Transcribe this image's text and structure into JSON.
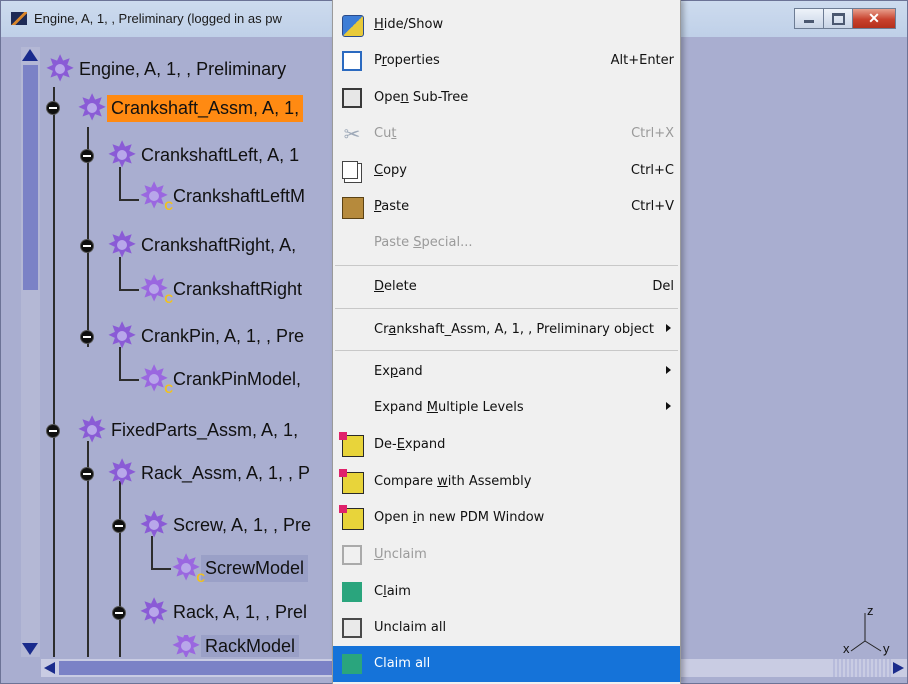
{
  "window": {
    "title": "Engine, A, 1, , Preliminary (logged in as pw",
    "controls": {
      "minimize": "minimize-icon",
      "maximize": "maximize-icon",
      "close": "✕"
    }
  },
  "tree": {
    "nodes": [
      {
        "label": "Engine, A, 1, , Preliminary"
      },
      {
        "label": "Crankshaft_Assm, A, 1,"
      },
      {
        "label": "CrankshaftLeft, A, 1"
      },
      {
        "label": "CrankshaftLeftM"
      },
      {
        "label": "CrankshaftRight, A,"
      },
      {
        "label": "CrankshaftRight"
      },
      {
        "label": "CrankPin, A, 1, , Pre"
      },
      {
        "label": "CrankPinModel,"
      },
      {
        "label": "FixedParts_Assm, A, 1,"
      },
      {
        "label": "Rack_Assm, A, 1, , P"
      },
      {
        "label": "Screw, A, 1, , Pre"
      },
      {
        "label": "ScrewModel"
      },
      {
        "label": "Rack, A, 1, , Prel"
      },
      {
        "label": "RackModel"
      }
    ],
    "model_badge": "C"
  },
  "axis": {
    "z": "z",
    "x": "x",
    "y": "y"
  },
  "menu": {
    "items": [
      {
        "label_pre": "",
        "ul": "H",
        "label_post": "ide/Show",
        "shortcut": "",
        "icon": "hide-show-icon"
      },
      {
        "label_pre": "P",
        "ul": "r",
        "label_post": "operties",
        "shortcut": "Alt+Enter",
        "icon": "properties-icon"
      },
      {
        "label_pre": "Ope",
        "ul": "n",
        "label_post": " Sub-Tree",
        "shortcut": "",
        "icon": "open-subtree-icon"
      },
      {
        "label_pre": "Cu",
        "ul": "t",
        "label_post": "",
        "shortcut": "Ctrl+X",
        "icon": "cut-icon"
      },
      {
        "label_pre": "",
        "ul": "C",
        "label_post": "opy",
        "shortcut": "Ctrl+C",
        "icon": "copy-icon"
      },
      {
        "label_pre": "",
        "ul": "P",
        "label_post": "aste",
        "shortcut": "Ctrl+V",
        "icon": "paste-icon"
      },
      {
        "label_pre": "Paste ",
        "ul": "S",
        "label_post": "pecial...",
        "shortcut": "",
        "icon": ""
      },
      {
        "label_pre": "",
        "ul": "D",
        "label_post": "elete",
        "shortcut": "Del",
        "icon": ""
      },
      {
        "label_pre": "Cr",
        "ul": "a",
        "label_post": "nkshaft_Assm, A, 1, , Preliminary object",
        "shortcut": "",
        "icon": ""
      },
      {
        "label_pre": "Ex",
        "ul": "p",
        "label_post": "and",
        "shortcut": "",
        "icon": ""
      },
      {
        "label_pre": "Expand ",
        "ul": "M",
        "label_post": "ultiple Levels",
        "shortcut": "",
        "icon": ""
      },
      {
        "label_pre": "De-",
        "ul": "E",
        "label_post": "xpand",
        "shortcut": "",
        "icon": "de-expand-icon"
      },
      {
        "label_pre": "Compare ",
        "ul": "w",
        "label_post": "ith Assembly",
        "shortcut": "",
        "icon": "compare-assembly-icon"
      },
      {
        "label_pre": "Open ",
        "ul": "i",
        "label_post": "n new PDM Window",
        "shortcut": "",
        "icon": "pdm-window-icon"
      },
      {
        "label_pre": "",
        "ul": "U",
        "label_post": "nclaim",
        "shortcut": "",
        "icon": "unclaim-icon"
      },
      {
        "label_pre": "C",
        "ul": "l",
        "label_post": "aim",
        "shortcut": "",
        "icon": "claim-icon"
      },
      {
        "label_pre": "Unclaim all",
        "ul": "",
        "label_post": "",
        "shortcut": "",
        "icon": "unclaim-all-icon"
      },
      {
        "label_pre": "Claim all",
        "ul": "",
        "label_post": "",
        "shortcut": "",
        "icon": "claim-all-icon"
      }
    ]
  },
  "colors": {
    "selection": "#ff8a12",
    "menu_highlight": "#1573d9",
    "tree_bg": "#a9aed0"
  }
}
